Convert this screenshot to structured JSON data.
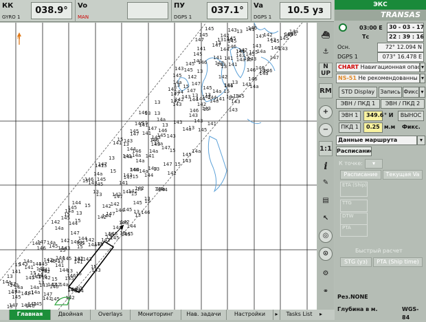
{
  "topbar": {
    "heading": {
      "label": "КК",
      "source": "GYRO 1",
      "value": "038.9°"
    },
    "speed": {
      "label": "Vo",
      "source": "MAN",
      "value": ""
    },
    "course": {
      "label": "ПУ",
      "source": "DGPS 1",
      "value": "037.1°"
    },
    "sog": {
      "label": "Va",
      "source": "DGPS 1",
      "value": "10.5 уз"
    }
  },
  "rpanel": {
    "mode_title": "ЭКС",
    "brand": "TRANSAS",
    "time": "03:00 Е",
    "date": "30 - 03 - 17",
    "tc_label": "Тс",
    "tc_time": "22 : 39 : 16",
    "pos_src_label": "Осн.",
    "lat": "72° 12.094 N",
    "pos_sensor": "DGPS 1",
    "lon": "073° 16.478 E",
    "chart_label": "CHART",
    "chart_value": "Навигационная опас",
    "ns_label": "NS-51",
    "ns_value": "Не рекомендованны",
    "std_display": "STD Display",
    "record": "Запись",
    "fix": "Фикс",
    "ebl_vrm1": "ЭВН / ПКД 1",
    "ebl_vrm2": "ЭВН / ПКД 2",
    "evn1_btn": "ЭВН 1",
    "evn1_value": "349.6",
    "evn1_unit": "° И",
    "vynos": "ВЫНОС",
    "pkd1_btn": "ПКД 1",
    "pkd1_value": "0.25",
    "pkd1_unit": "м.м",
    "fix2": "Фикс.",
    "route_data": "Данные маршрута",
    "schedule_tab": "Расписание",
    "to_point": "К точке:",
    "schedule_btn": "Расписание",
    "current_va": "Текущая Va",
    "eta": "ETA (Ship)",
    "ttg": "TTG",
    "dtw": "DTW",
    "pta": "PTA",
    "quick_calc": "Быстрый расчет",
    "stg": "STG (уз)",
    "pta_ship": "PTA (Ship time)",
    "rez": "Рез.NONE",
    "depth_m": "Глубина в м.",
    "wgs": "WGS-84"
  },
  "bottom_tabs": [
    "Главная",
    "Двойная",
    "Overlays",
    "Мониторинг",
    "Нав. задачи",
    "Настройки",
    "Tasks List"
  ],
  "chart_data": {
    "depths": [
      "143",
      "14a",
      "141",
      "147",
      "145",
      "144",
      "15",
      "13",
      "146",
      "142"
    ]
  },
  "tools": [
    "N UP",
    "RM",
    "1:1"
  ],
  "colors": {
    "accent": "#1c8f3a",
    "chart_bg": "#ffffff",
    "depth_contour": "#5aa0d8"
  }
}
